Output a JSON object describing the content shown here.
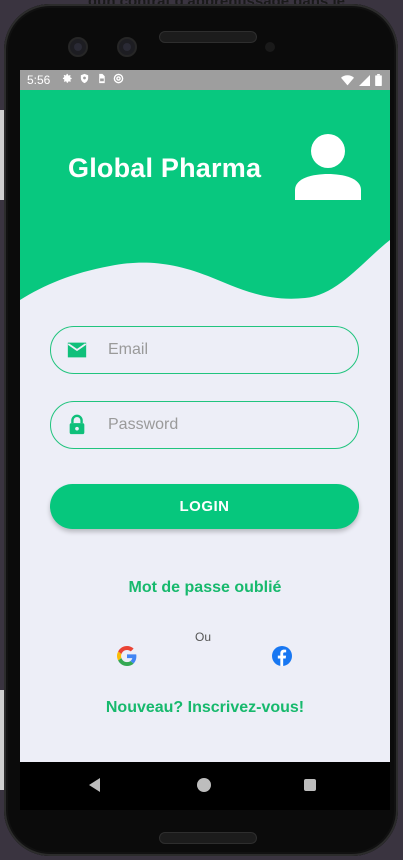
{
  "background": {
    "overflow_text": "dun contrat d'apprentissage dans le"
  },
  "status_bar": {
    "time": "5:56",
    "left_icons": [
      "settings-icon",
      "shield-icon",
      "sim-icon",
      "at-icon"
    ],
    "right_icons": [
      "wifi-icon",
      "signal-icon",
      "battery-icon"
    ]
  },
  "header": {
    "title": "Global Pharma",
    "avatar_icon": "user-icon",
    "color": "#08c87f"
  },
  "form": {
    "email_placeholder": "Email",
    "email_value": "",
    "password_placeholder": "Password",
    "password_value": "",
    "login_label": "LOGIN"
  },
  "links": {
    "forgot_password": "Mot de passe oublié",
    "or": "Ou",
    "register": "Nouveau? Inscrivez-vous!"
  },
  "social": [
    "google-icon",
    "facebook-icon"
  ],
  "nav_bar": {
    "buttons": [
      "back",
      "home",
      "recents"
    ]
  },
  "colors": {
    "accent": "#06c77d",
    "link": "#17b96d",
    "screen_bg": "#edeef7",
    "status_bar": "#9e9e9e"
  }
}
